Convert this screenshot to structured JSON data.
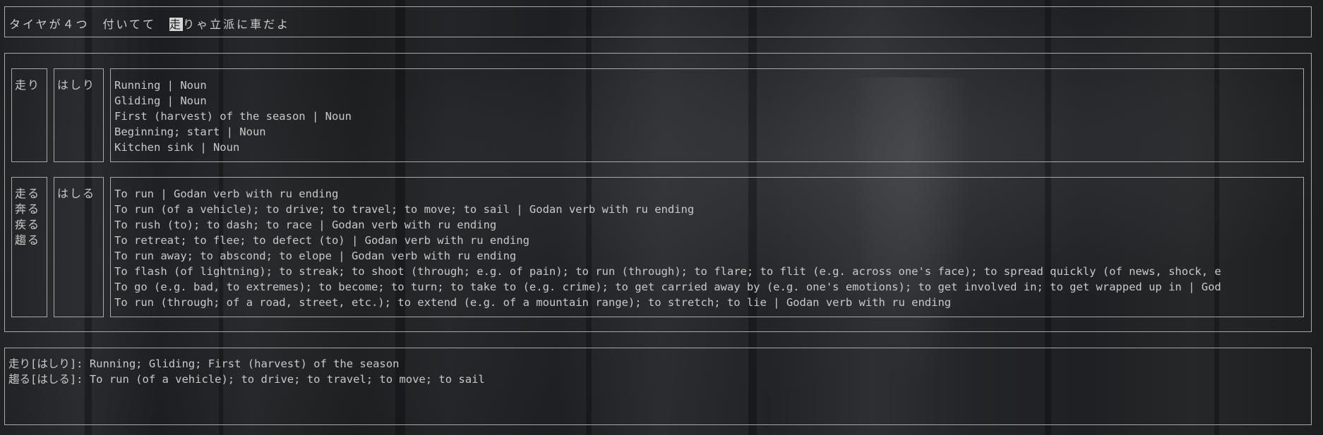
{
  "sentence": {
    "before": "タイヤが４つ　付いてて　",
    "highlight": "走",
    "after": "りゃ立派に車だよ"
  },
  "entries": [
    {
      "kanji": [
        "走り"
      ],
      "kana": "はしり",
      "definitions": [
        "Running | Noun",
        "Gliding | Noun",
        "First (harvest) of the season | Noun",
        "Beginning; start | Noun",
        "Kitchen sink | Noun"
      ]
    },
    {
      "kanji": [
        "走る",
        "奔る",
        "疾る",
        "趨る"
      ],
      "kana": "はしる",
      "definitions": [
        "To run | Godan verb with ru ending",
        "To run (of a vehicle); to drive; to travel; to move; to sail | Godan verb with ru ending",
        "To rush (to); to dash; to race | Godan verb with ru ending",
        "To retreat; to flee; to defect (to) | Godan verb with ru ending",
        "To run away; to abscond; to elope | Godan verb with ru ending",
        "To flash (of lightning); to streak; to shoot (through; e.g. of pain); to run (through); to flare; to flit (e.g. across one's face); to spread quickly (of news, shock, e",
        "To go (e.g. bad, to extremes); to become; to turn; to take to (e.g. crime); to get carried away by (e.g. one's emotions); to get involved in; to get wrapped up in | God",
        "To run (through; of a road, street, etc.); to extend (e.g. of a mountain range); to stretch; to lie | Godan verb with ru ending"
      ]
    }
  ],
  "summary": [
    "走り[はしり]: Running; Gliding; First (harvest) of the season",
    "趨る[はしる]: To run (of a vehicle); to drive; to travel; to move; to sail"
  ]
}
